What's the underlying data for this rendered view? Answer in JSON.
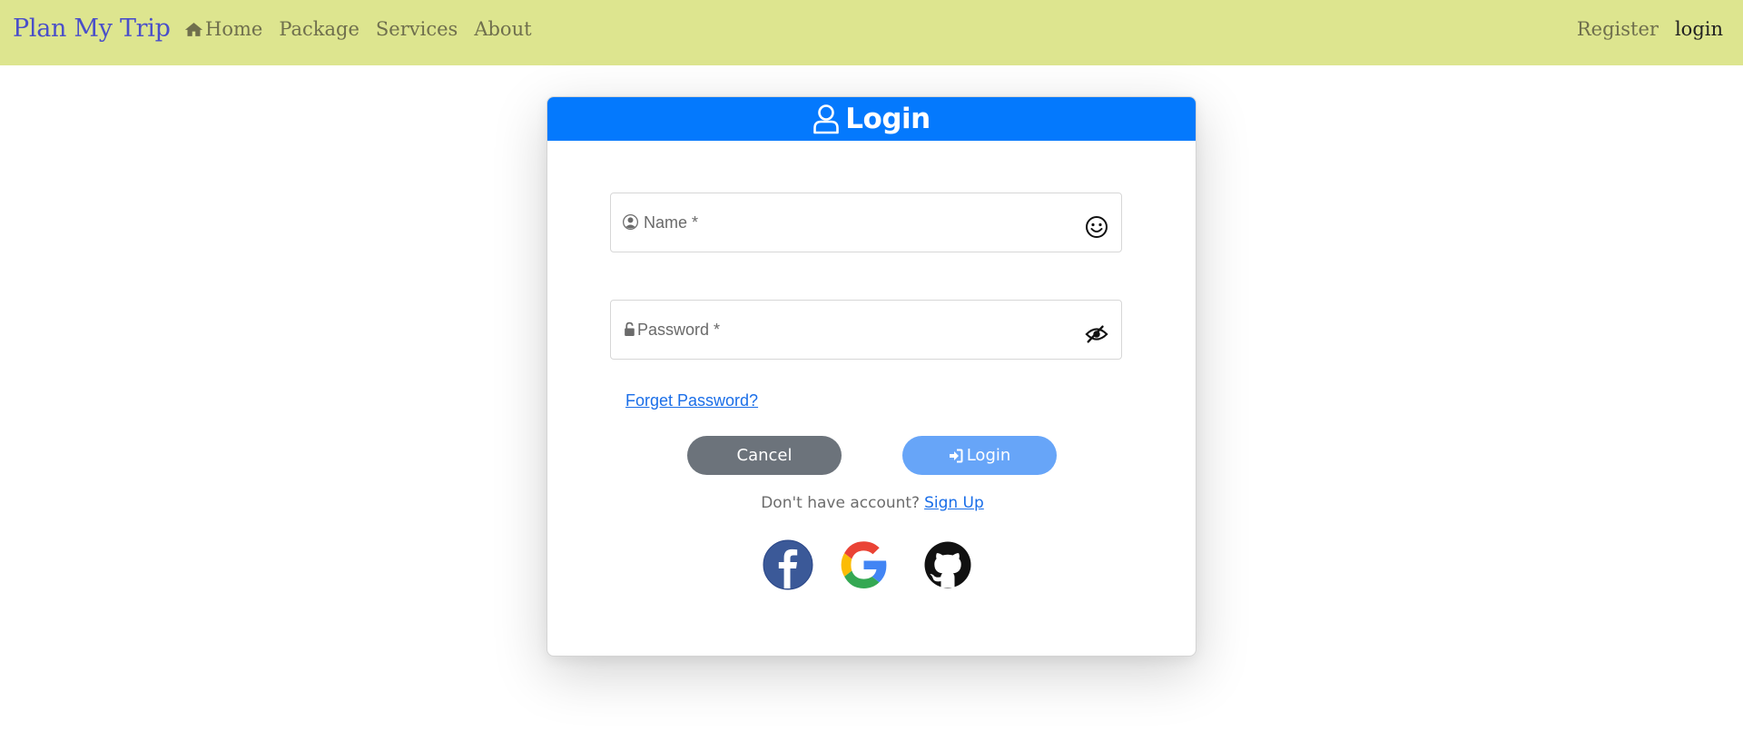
{
  "navbar": {
    "brand": "Plan My Trip",
    "links": [
      {
        "label": "Home",
        "icon": "home-icon"
      },
      {
        "label": "Package"
      },
      {
        "label": "Services"
      },
      {
        "label": "About"
      }
    ],
    "register_label": "Register",
    "login_label": "login"
  },
  "login_card": {
    "title": "Login",
    "title_icon": "user-icon",
    "name_field": {
      "placeholder": "Name *",
      "left_icon": "user-circle-icon",
      "right_icon": "smiley-icon"
    },
    "password_field": {
      "placeholder": "Password *",
      "left_icon": "unlock-icon",
      "right_icon": "eye-slash-icon"
    },
    "forget_label": "Forget Password?",
    "cancel_label": "Cancel",
    "login_label": "Login",
    "signup_prompt": "Don't have account?",
    "signup_label": "Sign Up",
    "social": [
      "facebook-icon",
      "google-icon",
      "github-icon"
    ]
  },
  "colors": {
    "navbar_bg": "#dde58f",
    "brand": "#4a4fc9",
    "header_blue": "#0479fd",
    "cancel_gray": "#6c737b",
    "login_blue": "#67a5f8",
    "link_blue": "#1a6ee8"
  }
}
